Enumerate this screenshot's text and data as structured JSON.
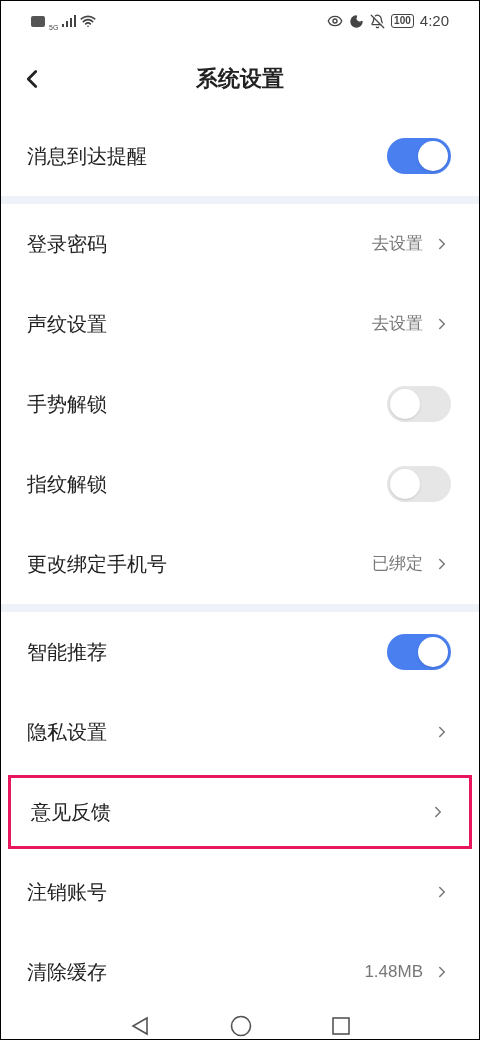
{
  "status_bar": {
    "network": "5G",
    "time": "4:20",
    "battery": "100"
  },
  "header": {
    "title": "系统设置"
  },
  "sections": [
    {
      "items": [
        {
          "kind": "toggle",
          "label": "消息到达提醒",
          "on": true,
          "highlighted": false
        }
      ]
    },
    {
      "items": [
        {
          "kind": "link",
          "label": "登录密码",
          "value": "去设置",
          "highlighted": false
        },
        {
          "kind": "link",
          "label": "声纹设置",
          "value": "去设置",
          "highlighted": false
        },
        {
          "kind": "toggle",
          "label": "手势解锁",
          "on": false,
          "highlighted": false
        },
        {
          "kind": "toggle",
          "label": "指纹解锁",
          "on": false,
          "highlighted": false
        },
        {
          "kind": "link",
          "label": "更改绑定手机号",
          "value": "已绑定",
          "highlighted": false
        }
      ]
    },
    {
      "items": [
        {
          "kind": "toggle",
          "label": "智能推荐",
          "on": true,
          "highlighted": false
        },
        {
          "kind": "link",
          "label": "隐私设置",
          "highlighted": false
        },
        {
          "kind": "link",
          "label": "意见反馈",
          "highlighted": true
        },
        {
          "kind": "link",
          "label": "注销账号",
          "highlighted": false
        },
        {
          "kind": "link",
          "label": "清除缓存",
          "value": "1.48MB",
          "highlighted": false
        }
      ]
    }
  ]
}
